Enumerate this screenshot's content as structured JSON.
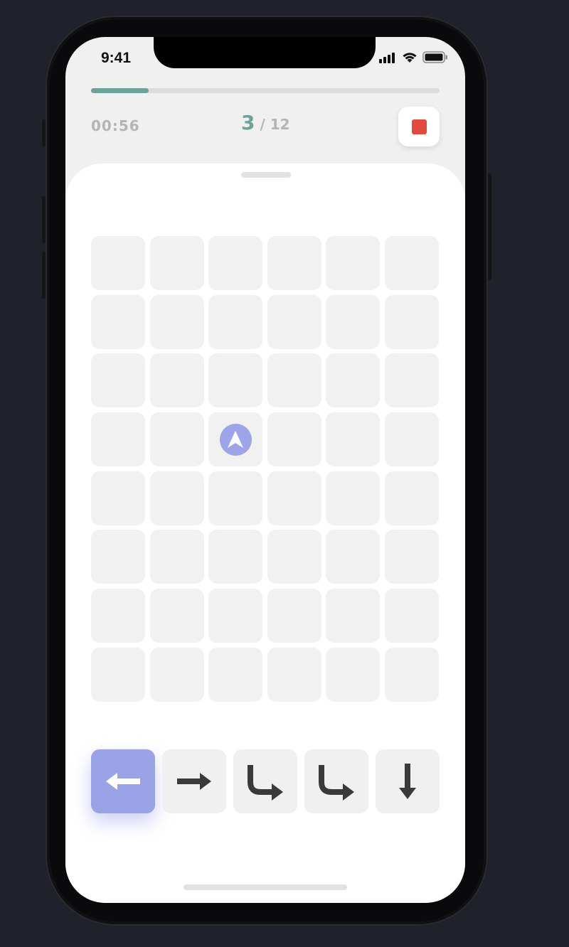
{
  "status_bar": {
    "time": "9:41",
    "icons": [
      "signal-icon",
      "wifi-icon",
      "battery-icon"
    ]
  },
  "progress": {
    "fraction": 0.165,
    "color": "#6fa39a"
  },
  "header": {
    "timer": "00:56",
    "step_current": "3",
    "step_total": "/ 12",
    "stop_button_icon": "stop-icon",
    "stop_color": "#e04a3f"
  },
  "grid": {
    "columns": 6,
    "rows": 8,
    "cursor": {
      "row": 4,
      "col": 3,
      "icon": "navigation-arrow-icon",
      "color": "#9da5e8"
    }
  },
  "commands": [
    {
      "icon": "arrow-left-icon",
      "selected": true
    },
    {
      "icon": "arrow-right-icon",
      "selected": false
    },
    {
      "icon": "turn-right-icon",
      "selected": false
    },
    {
      "icon": "turn-right-icon",
      "selected": false
    },
    {
      "icon": "arrow-down-icon",
      "selected": false
    }
  ],
  "colors": {
    "accent": "#9aa3e6",
    "background": "#1f212b"
  }
}
